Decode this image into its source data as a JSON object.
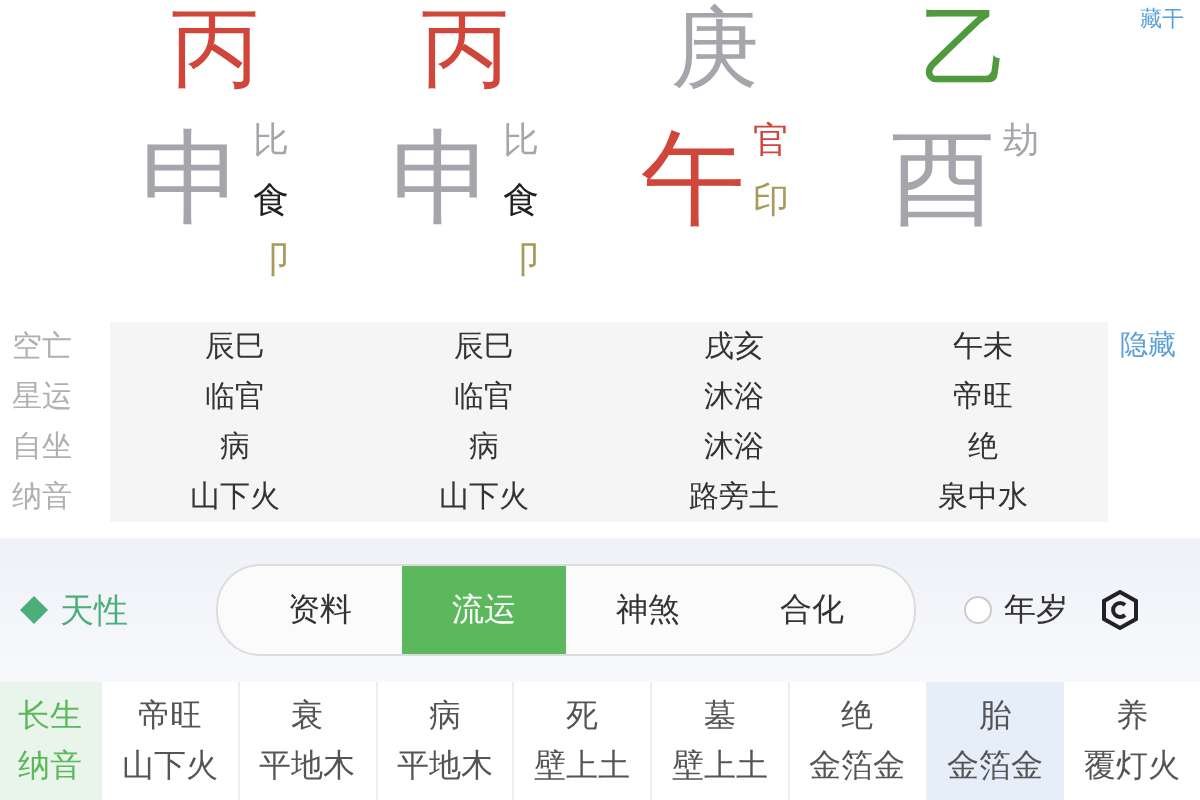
{
  "stems": [
    {
      "char": "丙",
      "color": "#d0463b"
    },
    {
      "char": "丙",
      "color": "#d0463b"
    },
    {
      "char": "庚",
      "color": "#a4a6ab"
    },
    {
      "char": "乙",
      "color": "#4e9a3c"
    }
  ],
  "hidden_link": "藏干",
  "branches": [
    {
      "char": "申",
      "color": "#a4a6ab",
      "gods": [
        {
          "text": "比",
          "color": "#a4a6ab"
        },
        {
          "text": "食",
          "color": "#222222"
        },
        {
          "text": "卩",
          "color": "#a89a58"
        }
      ]
    },
    {
      "char": "申",
      "color": "#a4a6ab",
      "gods": [
        {
          "text": "比",
          "color": "#a4a6ab"
        },
        {
          "text": "食",
          "color": "#222222"
        },
        {
          "text": "卩",
          "color": "#a89a58"
        }
      ]
    },
    {
      "char": "午",
      "color": "#d0463b",
      "gods": [
        {
          "text": "官",
          "color": "#d0463b"
        },
        {
          "text": "印",
          "color": "#a89a58"
        }
      ]
    },
    {
      "char": "酉",
      "color": "#a4a6ab",
      "gods": [
        {
          "text": "劫",
          "color": "#a4a6ab"
        }
      ]
    }
  ],
  "table": {
    "action": "隐藏",
    "rows": [
      {
        "label": "空亡",
        "cells": [
          "辰巳",
          "辰巳",
          "戌亥",
          "午未"
        ]
      },
      {
        "label": "星运",
        "cells": [
          "临官",
          "临官",
          "沐浴",
          "帝旺"
        ]
      },
      {
        "label": "自坐",
        "cells": [
          "病",
          "病",
          "沐浴",
          "绝"
        ]
      },
      {
        "label": "纳音",
        "cells": [
          "山下火",
          "山下火",
          "路旁土",
          "泉中水"
        ]
      }
    ]
  },
  "section": {
    "title": "天性",
    "tabs": [
      {
        "label": "资料",
        "selected": false
      },
      {
        "label": "流运",
        "selected": true
      },
      {
        "label": "神煞",
        "selected": false
      },
      {
        "label": "合化",
        "selected": false
      }
    ],
    "radio": {
      "label": "年岁",
      "checked": false
    }
  },
  "cycle": {
    "labels": [
      "长生",
      "纳音"
    ],
    "columns": [
      {
        "lines": [
          "帝旺",
          "山下火"
        ],
        "selected": false
      },
      {
        "lines": [
          "衰",
          "平地木"
        ],
        "selected": false
      },
      {
        "lines": [
          "病",
          "平地木"
        ],
        "selected": false
      },
      {
        "lines": [
          "死",
          "壁上土"
        ],
        "selected": false
      },
      {
        "lines": [
          "墓",
          "壁上土"
        ],
        "selected": false
      },
      {
        "lines": [
          "绝",
          "金箔金"
        ],
        "selected": false
      },
      {
        "lines": [
          "胎",
          "金箔金"
        ],
        "selected": true
      },
      {
        "lines": [
          "养",
          "覆灯火"
        ],
        "selected": false
      }
    ]
  }
}
